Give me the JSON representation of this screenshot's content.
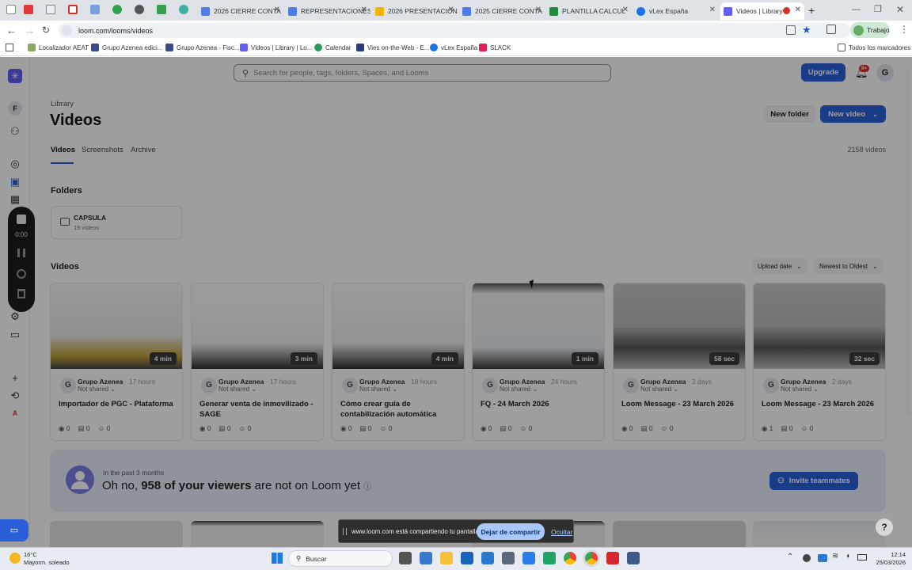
{
  "tabs": [
    {
      "label": "2026 CIERRE CONTA",
      "color": "#4f7de8"
    },
    {
      "label": "REPRESENTACIONES",
      "color": "#4f7de8"
    },
    {
      "label": "2026 PRESENTACIÓN",
      "color": "#f4b400"
    },
    {
      "label": "2025 CIERRE CONTA",
      "color": "#4f7de8"
    },
    {
      "label": "PLANTILLA CALCUL",
      "color": "#1e8e3e"
    },
    {
      "label": "vLex España",
      "color": "#1a73e8"
    },
    {
      "label": "Videos | Library",
      "color": "#625df5"
    }
  ],
  "address": {
    "url": "loom.com/looms/videos",
    "profile": "Trabajo"
  },
  "bookmarks": [
    "Localizador AEAT",
    "Grupo Azenea edici...",
    "Grupo Azenea - Fisc...",
    "Videos | Library | Lo...",
    "Calendar",
    "Vies on-the-Web - E...",
    "vLex España",
    "SLACK"
  ],
  "all_bookmarks": "Todos los marcadores",
  "nav": {
    "workspace_initial": "F",
    "user_initial_side": "A",
    "timer": "0:00"
  },
  "header": {
    "search_placeholder": "Search for people, tags, folders, Spaces, and Looms",
    "upgrade": "Upgrade",
    "notification_count": "9+",
    "user_initial": "G"
  },
  "library": {
    "breadcrumb": "Library",
    "title": "Videos",
    "new_folder": "New folder",
    "new_video": "New video",
    "tabs": [
      "Videos",
      "Screenshots",
      "Archive"
    ],
    "count": "2158 videos"
  },
  "folders": {
    "heading": "Folders",
    "items": [
      {
        "name": "CAPSULA",
        "count": "19 videos"
      }
    ]
  },
  "videos": {
    "heading": "Videos",
    "sort_field": "Upload date",
    "sort_order": "Newest to Oldest",
    "items": [
      {
        "duration": "4 min",
        "initial": "G",
        "owner": "Grupo Azenea",
        "time": "· 17 hours",
        "shared": "Not shared",
        "title": "Importador de PGC - Plataforma",
        "views": "0",
        "comments": "0",
        "reactions": "0"
      },
      {
        "duration": "3 min",
        "initial": "G",
        "owner": "Grupo Azenea",
        "time": "· 17 hours",
        "shared": "Not shared",
        "title": "Generar venta de inmovilizado - SAGE",
        "views": "0",
        "comments": "0",
        "reactions": "0"
      },
      {
        "duration": "4 min",
        "initial": "G",
        "owner": "Grupo Azenea",
        "time": "· 18 hours",
        "shared": "Not shared",
        "title": "Cómo crear guía de contabilización automática",
        "views": "0",
        "comments": "0",
        "reactions": "0"
      },
      {
        "duration": "1 min",
        "initial": "G",
        "owner": "Grupo Azenea",
        "time": "· 24 hours",
        "shared": "Not shared",
        "title": "FQ - 24 March 2026",
        "views": "0",
        "comments": "0",
        "reactions": "0"
      },
      {
        "duration": "58 sec",
        "initial": "G",
        "owner": "Grupo Azenea",
        "time": "· 2 days",
        "shared": "Not shared",
        "title": "Loom Message - 23 March 2026",
        "views": "0",
        "comments": "0",
        "reactions": "0"
      },
      {
        "duration": "32 sec",
        "initial": "G",
        "owner": "Grupo Azenea",
        "time": "· 2 days",
        "shared": "Not shared",
        "title": "Loom Message - 23 March 2026",
        "views": "1",
        "comments": "0",
        "reactions": "0"
      }
    ]
  },
  "banner": {
    "subtitle": "In the past 3 months",
    "text_prefix": "Oh no,",
    "text_bold": "958 of your viewers",
    "text_suffix": "are not on Loom yet",
    "invite": "Invite teammates"
  },
  "share_bar": {
    "message": "www.loom.com está compartiendo tu pantalla.",
    "stop": "Dejar de compartir",
    "hide": "Ocultar"
  },
  "help": "?",
  "taskbar": {
    "weather_temp": "16°C",
    "weather_desc": "Mayorm. soleado",
    "search": "Buscar",
    "time": "12:14",
    "date": "25/03/2026"
  }
}
